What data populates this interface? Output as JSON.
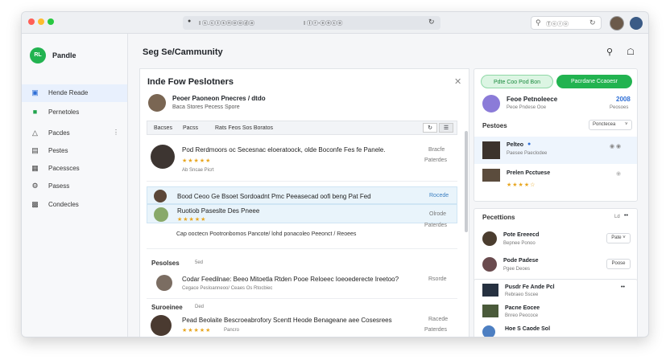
{
  "browser": {
    "url": "Ⅰ ⓢ.ⓒⓣⓢⓝⓞⓞⓓⓐ",
    "url2": "Ⅰ Ⓘⓡ-ⓔⓝⓒⓞ",
    "search_placeholder": "Ⓣⓔⓡⓞ"
  },
  "sidebar": {
    "logo_text": "RL",
    "brand": "Pandle",
    "items": [
      {
        "label": "Hende Reade",
        "icon": "person-icon",
        "active": true
      },
      {
        "label": "Pernetoles",
        "icon": "calendar-icon",
        "active": false
      },
      {
        "label": "Pacdes",
        "icon": "triangle-icon",
        "active": false
      },
      {
        "label": "Pestes",
        "icon": "grid-icon",
        "active": false
      },
      {
        "label": "Pacessces",
        "icon": "clock-icon",
        "active": false
      },
      {
        "label": "Pasess",
        "icon": "settings-icon",
        "active": false
      },
      {
        "label": "Condecles",
        "icon": "video-icon",
        "active": false
      }
    ]
  },
  "header": {
    "title": "Seg Se/Cammunity"
  },
  "panel": {
    "title": "Inde Fow Peslotners",
    "profile": {
      "name": "Peoer Paoneon Pnecres / dtdo",
      "sub": "Baca Stores Pecess Spore"
    },
    "tabs": [
      "Bacses",
      "Pacss",
      "Rats Feos Sos Boratos"
    ],
    "posts": [
      {
        "text": "Pod Rerdmoors oc Secesnac eloeratoock, olde Boconfe Fes fe Panele.",
        "meta": "Ab Sncae Picrt",
        "time1": "Bracfe",
        "time2": "Paterdes"
      },
      {
        "text": "Bood Ceoo Ge Bsoet Sordoadnt Pmc Peeasecad oofi beng Pat Fed",
        "time1": "Rocede",
        "highlight": true
      },
      {
        "text": "Ruotiob Paseslte Des Pneee",
        "sub": "Cap ooctecn Pootronbomos Pancote/ lohd ponacoleo Peeonct / Reoees",
        "time1": "Olrode",
        "time2": "Paterdes"
      }
    ],
    "section1": "Pesolses",
    "section1_count": "5ed",
    "post4": {
      "text": "Codar Feedilnae: Beeo Mitoetla Rtden Pooe Reloeec Ioeoederecte Ireetoo?",
      "sub": "Cegace Pesloanneoo/ Ceaes Os Rtocbiec",
      "time": "Rsorde"
    },
    "section2": "Suroeinee",
    "section2_count": "Ded",
    "post5": {
      "text": "Pead Beolaite Bescroeabrofory Scentt Heode Benageane aee Cosesrees",
      "meta": "Pancro",
      "time1": "Racede",
      "time2": "Paterdes"
    }
  },
  "right": {
    "btn1": "Pdte Coo Pod Bon",
    "btn2": "Pacrdane Ccaoesr",
    "profile": {
      "name": "Feoe Petnoleece",
      "sub": "Peoe Pndese Ooe",
      "count": "2008",
      "count_sub": "Peosoes"
    },
    "section": "Pestoes",
    "dropdown": "Ponctecea",
    "rows": [
      {
        "name": "Pelteo",
        "sub": "Paesee Paeclodee"
      },
      {
        "name": "Prelen Pcctuese",
        "sub": ""
      }
    ],
    "section2": "Pecettions",
    "section2_count": "Ld",
    "list2": [
      {
        "name": "Pote Ereeecd",
        "sub": "Bepnee Ponoo",
        "btn": "Pate"
      },
      {
        "name": "Pode Padese",
        "sub": "Pgee Deoes",
        "btn": "Poose"
      }
    ],
    "list3": [
      {
        "name": "Pusdr Fe Ande Pcl",
        "sub": "Rebraeo Sscee"
      },
      {
        "name": "Pacne Eocee",
        "sub": "Bnreo Peococe"
      },
      {
        "name": "Hoe S Caode Sol",
        "sub": ""
      }
    ]
  }
}
